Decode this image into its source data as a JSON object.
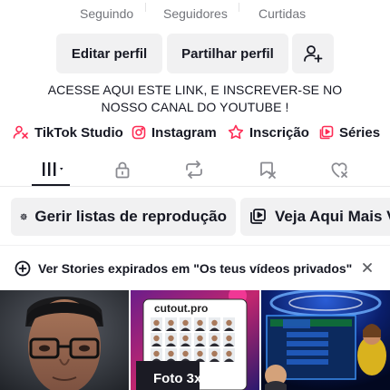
{
  "stats": {
    "following_label": "Seguindo",
    "followers_label": "Seguidores",
    "likes_label": "Curtidas"
  },
  "actions": {
    "edit_label": "Editar perfil",
    "share_label": "Partilhar perfil",
    "add_friend_icon": "add-user-icon"
  },
  "bio": {
    "line1": "ACESSE AQUI ESTE LINK, E INSCREVER-SE NO",
    "line2": "NOSSO CANAL DO YOUTUBE !"
  },
  "links": [
    {
      "label": "TikTok Studio",
      "icon": "tiktok-studio-icon",
      "color": "#fe2c55"
    },
    {
      "label": "Instagram",
      "icon": "instagram-icon",
      "color": "#fe2c55"
    },
    {
      "label": "Inscrição",
      "icon": "subscription-icon",
      "color": "#fe2c55"
    },
    {
      "label": "Séries",
      "icon": "series-icon",
      "color": "#fe2c55"
    }
  ],
  "tabs": [
    {
      "name": "videos-tab",
      "icon": "grid-bars-icon",
      "active": true
    },
    {
      "name": "private-tab",
      "icon": "lock-icon",
      "active": false
    },
    {
      "name": "reposts-tab",
      "icon": "repost-icon",
      "active": false
    },
    {
      "name": "favorites-tab",
      "icon": "bookmark-icon",
      "active": false
    },
    {
      "name": "liked-tab",
      "icon": "heart-icon",
      "active": false
    }
  ],
  "pills": {
    "playlists_label": "Gerir listas de reprodução",
    "more_label": "Veja Aqui Mais V"
  },
  "banner": {
    "text": "Ver Stories expirados em \"Os teus vídeos privados\""
  },
  "thumbs": [
    {
      "type": "selfie"
    },
    {
      "brand": "cutout.pro",
      "caption": "Foto 3x4"
    },
    {
      "type": "tv-show"
    }
  ],
  "colors": {
    "accent": "#fe2c55",
    "text": "#161823",
    "muted": "#73757b",
    "button_bg": "#f1f1f2"
  }
}
